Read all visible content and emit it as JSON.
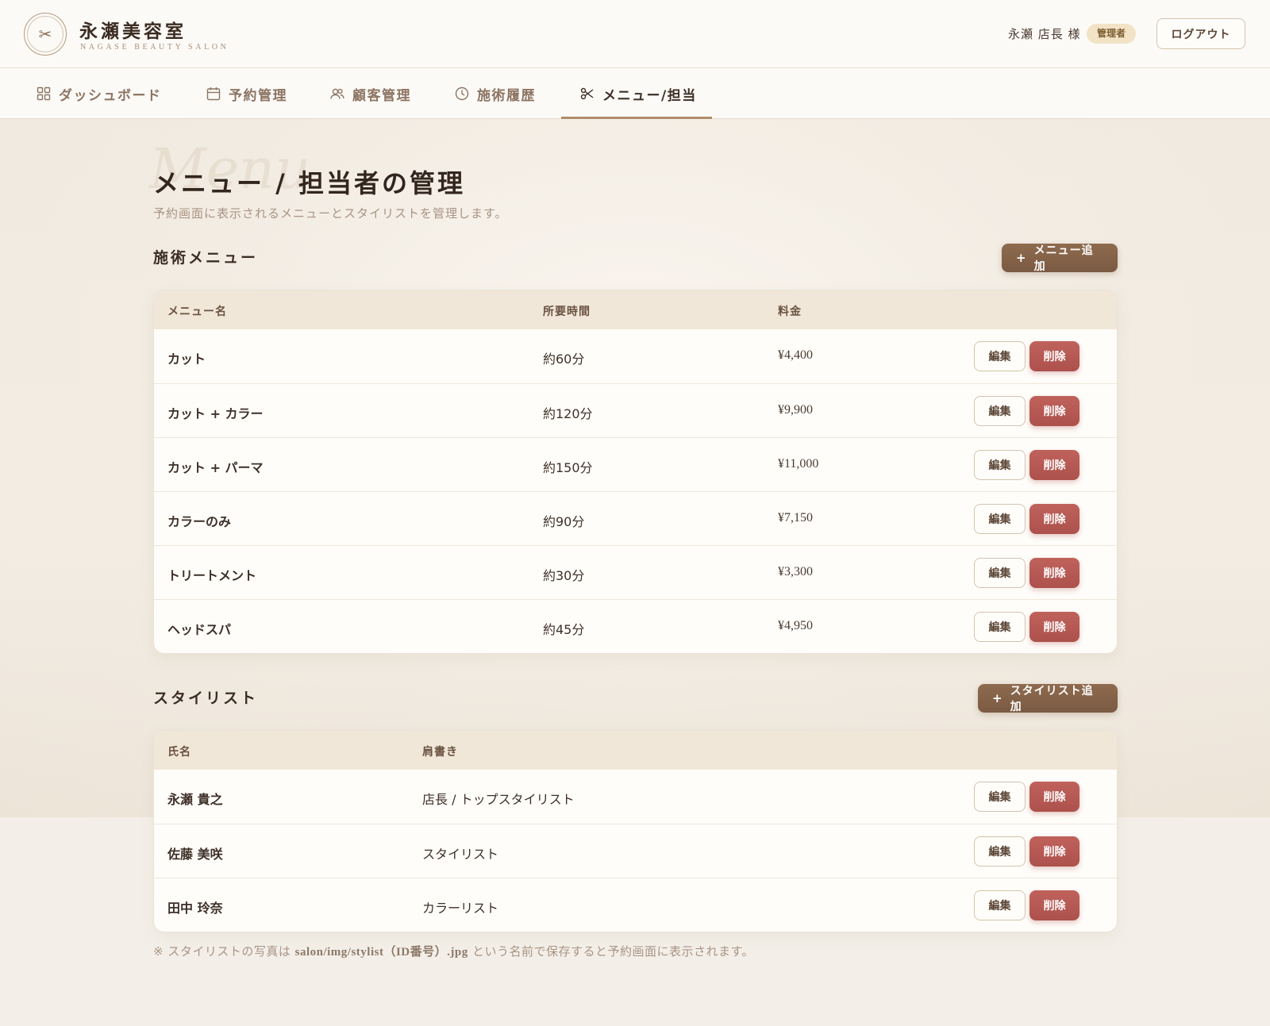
{
  "header": {
    "logo_icon": "scissors-icon",
    "brand_title": "永瀬美容室",
    "brand_sub": "NAGASE BEAUTY SALON",
    "user_name": "永瀬 店長 様",
    "role_badge": "管理者",
    "logout_label": "ログアウト"
  },
  "nav": {
    "items": [
      {
        "label": "ダッシュボード",
        "icon": "dashboard-grid-icon"
      },
      {
        "label": "予約管理",
        "icon": "calendar-icon"
      },
      {
        "label": "顧客管理",
        "icon": "users-icon"
      },
      {
        "label": "施術履歴",
        "icon": "clock-icon"
      },
      {
        "label": "メニュー/担当",
        "icon": "scissors-icon",
        "active": true
      }
    ]
  },
  "page": {
    "watermark": "Menu",
    "title": "メニュー / 担当者の管理",
    "subtitle": "予約画面に表示されるメニューとスタイリストを管理します。"
  },
  "menu_section": {
    "title": "施術メニュー",
    "add_label": "メニュー追加",
    "columns": [
      "メニュー名",
      "所要時間",
      "料金"
    ],
    "rows": [
      {
        "name": "カット",
        "duration": "約60分",
        "price": "¥4,400"
      },
      {
        "name": "カット + カラー",
        "duration": "約120分",
        "price": "¥9,900"
      },
      {
        "name": "カット + パーマ",
        "duration": "約150分",
        "price": "¥11,000"
      },
      {
        "name": "カラーのみ",
        "duration": "約90分",
        "price": "¥7,150"
      },
      {
        "name": "トリートメント",
        "duration": "約30分",
        "price": "¥3,300"
      },
      {
        "name": "ヘッドスパ",
        "duration": "約45分",
        "price": "¥4,950"
      }
    ]
  },
  "stylist_section": {
    "title": "スタイリスト",
    "add_label": "スタイリスト追加",
    "columns": [
      "氏名",
      "肩書き"
    ],
    "rows": [
      {
        "name": "永瀬 貴之",
        "title": "店長 / トップスタイリスト"
      },
      {
        "name": "佐藤 美咲",
        "title": "スタイリスト"
      },
      {
        "name": "田中 玲奈",
        "title": "カラーリスト"
      }
    ]
  },
  "actions": {
    "edit_label": "編集",
    "delete_label": "削除",
    "plus": "+"
  },
  "footnote": {
    "prefix": "※ スタイリストの写真は ",
    "path": "salon/img/stylist（ID番号）.jpg",
    "suffix": " という名前で保存すると予約画面に表示されます。"
  },
  "colors": {
    "accent": "#8e6b4f",
    "danger": "#b8584f",
    "badge": "#f2e3c6"
  }
}
